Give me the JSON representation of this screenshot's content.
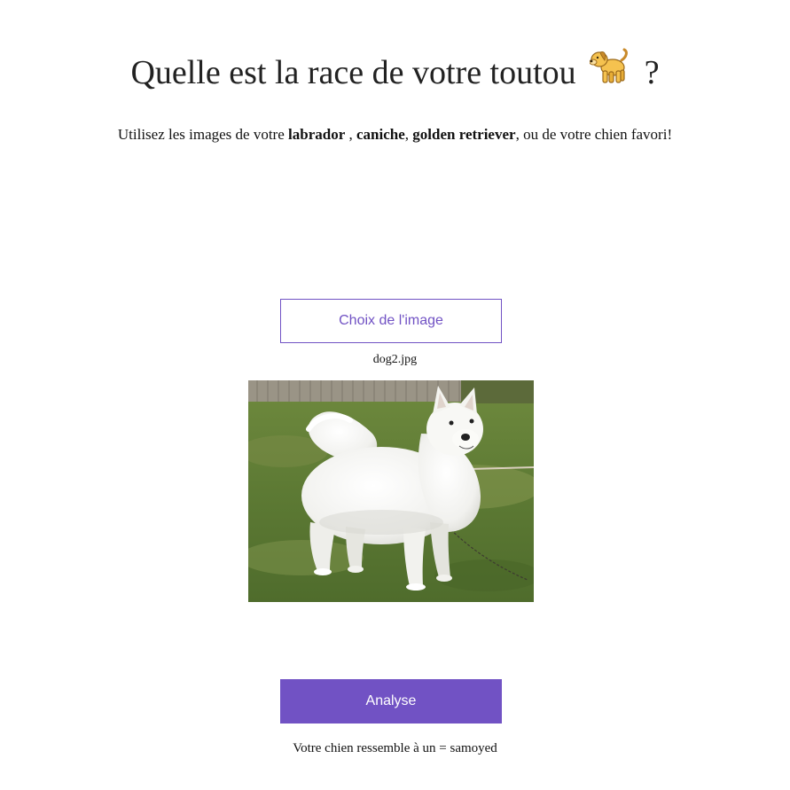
{
  "header": {
    "title_before": "Quelle est la race de votre toutou",
    "title_after": "?",
    "title_icon": "dog-icon"
  },
  "intro": {
    "text_1": "Utilisez les images de votre ",
    "breed_1": "labrador",
    "text_2": " , ",
    "breed_2": "caniche",
    "text_3": ", ",
    "breed_3": "golden retriever",
    "text_4": ", ou de votre chien favori!"
  },
  "upload": {
    "choose_label": "Choix de l'image",
    "file_name": "dog2.jpg",
    "preview_icon": "dog-photo"
  },
  "analysis": {
    "analyse_label": "Analyse",
    "result_text": "Votre chien ressemble à un = samoyed"
  },
  "colors": {
    "accent": "#7152c4",
    "text": "#222222",
    "background": "#ffffff"
  }
}
